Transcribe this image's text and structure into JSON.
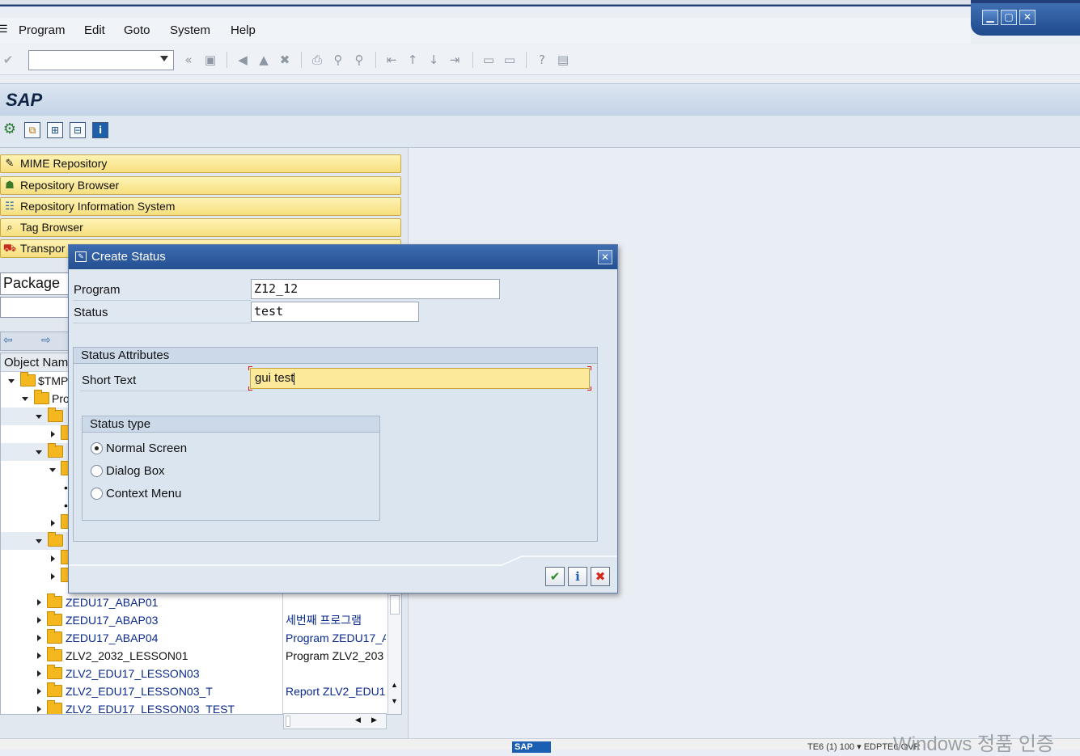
{
  "menubar": {
    "items": [
      "Program",
      "Edit",
      "Goto",
      "System",
      "Help"
    ]
  },
  "title": {
    "text": "SAP"
  },
  "left_nav": {
    "buttons": [
      "MIME Repository",
      "Repository Browser",
      "Repository Information System",
      "Tag Browser",
      "Transpor"
    ],
    "package_label": "Package",
    "tree_header": "Object Nam",
    "tree_rows": [
      {
        "name": "$TMP",
        "desc": ""
      },
      {
        "name": "Pro",
        "desc": ""
      },
      {
        "name": "ZEDU17_ABAP01",
        "desc": ""
      },
      {
        "name": "ZEDU17_ABAP03",
        "desc": "세번째 프로그램"
      },
      {
        "name": "ZEDU17_ABAP04",
        "desc": "Program ZEDU17_A"
      },
      {
        "name": "ZLV2_2032_LESSON01",
        "desc": "Program ZLV2_203"
      },
      {
        "name": "ZLV2_EDU17_LESSON03",
        "desc": ""
      },
      {
        "name": "ZLV2_EDU17_LESSON03_T",
        "desc": "Report ZLV2_EDU1"
      },
      {
        "name": "ZLV2_EDU17_LESSON03_TEST",
        "desc": ""
      }
    ]
  },
  "dialog": {
    "title": "Create Status",
    "program_label": "Program",
    "program_value": "Z12_12",
    "status_label": "Status",
    "status_value": "test",
    "attributes_title": "Status Attributes",
    "short_text_label": "Short Text",
    "short_text_value": "gui test",
    "status_type_title": "Status type",
    "status_type_options": [
      "Normal Screen",
      "Dialog Box",
      "Context Menu"
    ],
    "selected_status_type": "Normal Screen"
  },
  "statusbar": {
    "logo": "SAP",
    "system_info": "TE6 (1) 100 ▾   EDPTE6   OVR",
    "watermark": "Windows 정품 인증"
  },
  "colors": {
    "dialog_title": "#2d5a9c",
    "nav_button": "#f8e494",
    "required_field": "#fde99a"
  }
}
